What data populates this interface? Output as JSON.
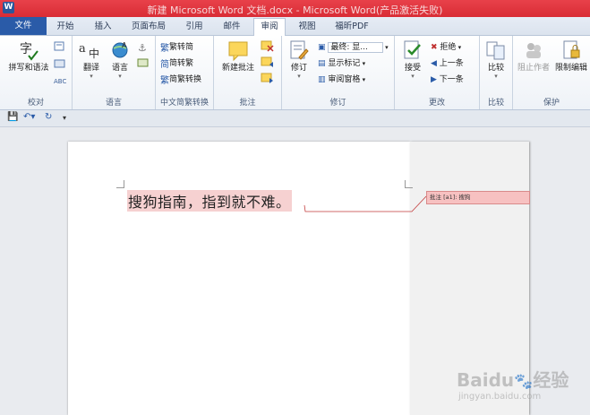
{
  "titlebar": {
    "title": "新建 Microsoft Word 文档.docx - Microsoft Word(产品激活失败)"
  },
  "tabs": [
    "文件",
    "开始",
    "插入",
    "页面布局",
    "引用",
    "邮件",
    "审阅",
    "视图",
    "福昕PDF"
  ],
  "ribbon": {
    "proofing": {
      "spelling": "拼写和语法",
      "group": "校对"
    },
    "language": {
      "translate": "翻译",
      "language": "语言",
      "group": "语言"
    },
    "chinese": {
      "trad": "繁转简",
      "simp": "简转繁",
      "convert": "简繁转换",
      "group": "中文简繁转换"
    },
    "comments": {
      "new": "新建批注",
      "group": "批注"
    },
    "tracking": {
      "track": "修订",
      "display": "最终: 显...",
      "show_markup": "显示标记",
      "pane": "审阅窗格",
      "group": "修订"
    },
    "changes": {
      "accept": "接受",
      "reject": "拒绝",
      "prev": "上一条",
      "next": "下一条",
      "group": "更改"
    },
    "compare": {
      "compare": "比较",
      "group": "比较"
    },
    "protect": {
      "block": "阻止作者",
      "restrict": "限制编辑",
      "group": "保护"
    }
  },
  "document": {
    "text": "搜狗指南，指到就不难。",
    "comment": "批注 [a1]: 搜狗"
  },
  "watermark": {
    "brand": "Baidu",
    "suffix": "经验",
    "url": "jingyan.baidu.com"
  }
}
